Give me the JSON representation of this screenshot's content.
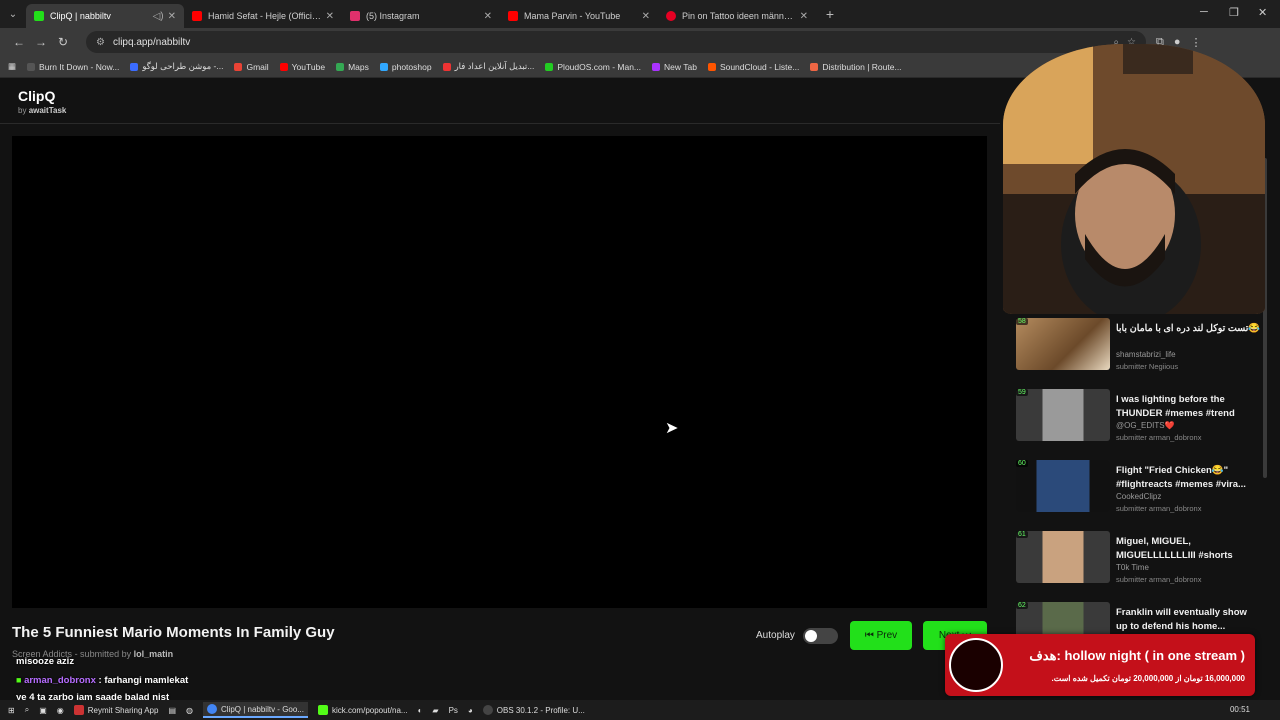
{
  "browser": {
    "tabs": [
      {
        "title": "ClipQ | nabbiltv",
        "color": "#22e01a",
        "active": true
      },
      {
        "title": "Hamid Sefat - Hejle (Official M...",
        "color": "#ff0000"
      },
      {
        "title": "(5) Instagram",
        "color": "#e1306c"
      },
      {
        "title": "Mama Parvin - YouTube",
        "color": "#ff0000"
      },
      {
        "title": "Pin on Tattoo ideen männer arm",
        "color": "#e60023"
      }
    ],
    "url": "clipq.app/nabbiltv",
    "bookmarks": [
      {
        "label": "Burn It Down - Now...",
        "color": "#555"
      },
      {
        "label": "موشن طراحی لوگو -...",
        "color": "#3b6cff"
      },
      {
        "label": "Gmail",
        "color": "#ea4335"
      },
      {
        "label": "YouTube",
        "color": "#ff0000"
      },
      {
        "label": "Maps",
        "color": "#34a853"
      },
      {
        "label": "photoshop",
        "color": "#31a8ff"
      },
      {
        "label": "تبدیل آنلاین اعداد فار...",
        "color": "#e33"
      },
      {
        "label": "PloudOS.com - Man...",
        "color": "#2c2"
      },
      {
        "label": "New Tab",
        "color": "#a3f"
      },
      {
        "label": "SoundCloud - Liste...",
        "color": "#f50"
      },
      {
        "label": "Distribution | Route...",
        "color": "#e64"
      },
      {
        "label": "Bookmarks",
        "color": "#777"
      }
    ]
  },
  "app": {
    "name": "ClipQ",
    "by_prefix": "by",
    "by_name": "awaitTask"
  },
  "video": {
    "title": "The 5 Funniest Mario Moments In Family Guy",
    "channel": "Screen Addicts",
    "submitted_prefix": "- submitted by",
    "submitter": "lol_matin"
  },
  "controls": {
    "autoplay_label": "Autoplay",
    "autoplay_on": false,
    "prev_label": "⏮ Prev",
    "next_label": "Next ⏭"
  },
  "queue": [
    {
      "num": "58",
      "title": "تست توکل لند دره ای با مامان بابا😂",
      "channel": "shamstabrizi_life",
      "submitter": "submitter Negiious",
      "thumb": "#8a6a4a"
    },
    {
      "num": "59",
      "title": "I was lighting before the THUNDER #memes #trend",
      "channel": "@OG_EDITS❤️",
      "submitter": "submitter arman_dobronx",
      "thumb": "#6b6b6b"
    },
    {
      "num": "60",
      "title": "Flight \"Fried Chicken😂\" #flightreacts #memes #vira...",
      "channel": "CookedClipz",
      "submitter": "submitter arman_dobronx",
      "thumb": "#1b2a4a"
    },
    {
      "num": "61",
      "title": "Miguel, MIGUEL, MIGUELLLLLLLIII #shorts",
      "channel": "T0k Time",
      "submitter": "submitter arman_dobronx",
      "thumb": "#b58a66"
    },
    {
      "num": "62",
      "title": "Franklin will eventually show up to defend his home...",
      "channel": "",
      "submitter": "",
      "thumb": "#5a6a4a"
    }
  ],
  "chat": [
    {
      "user": "",
      "message": "misooze aziz"
    },
    {
      "user": "arman_dobronx",
      "message": ": farhangi mamlekat"
    },
    {
      "user": "",
      "message": "ye 4 ta zarbo jam saade balad nist"
    }
  ],
  "goal": {
    "title": "hollow night ( in one stream ) :هدف",
    "progress": "16,000,000 تومان از 20,000,000 تومان تکمیل شده است.",
    "fraction": 0.8
  },
  "taskbar": {
    "items": [
      {
        "label": "Reymit Sharing App",
        "color": "#c33"
      },
      {
        "label": "ClipQ | nabbiltv - Goo...",
        "color": "#4285f4",
        "active": true
      },
      {
        "label": "kick.com/popout/na...",
        "color": "#53fc18"
      },
      {
        "label": "OBS 30.1.2 - Profile: U...",
        "color": "#444"
      }
    ],
    "time": "00:51"
  }
}
